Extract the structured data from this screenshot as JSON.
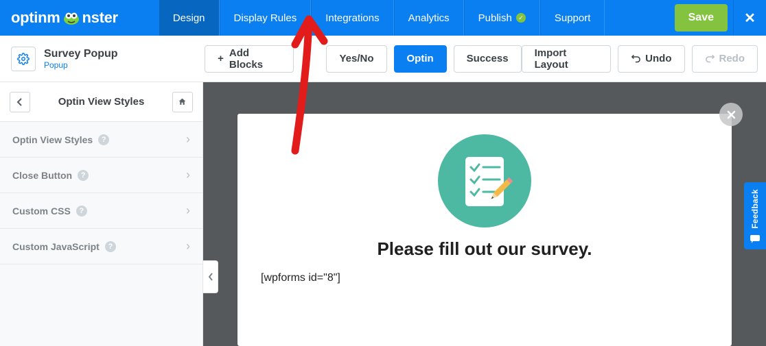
{
  "logo": {
    "part1": "optinm",
    "part2": "nster"
  },
  "topNav": {
    "tabs": [
      {
        "label": "Design",
        "active": true
      },
      {
        "label": "Display Rules"
      },
      {
        "label": "Integrations"
      },
      {
        "label": "Analytics"
      },
      {
        "label": "Publish",
        "badge": true
      },
      {
        "label": "Support"
      }
    ],
    "save": "Save"
  },
  "title": {
    "main": "Survey Popup",
    "sub": "Popup"
  },
  "toolbar": {
    "addBlocks": "Add Blocks",
    "views": {
      "yesno": "Yes/No",
      "optin": "Optin",
      "success": "Success"
    },
    "importLayout": "Import Layout",
    "undo": "Undo",
    "redo": "Redo"
  },
  "sidebar": {
    "header": "Optin View Styles",
    "items": [
      {
        "label": "Optin View Styles"
      },
      {
        "label": "Close Button"
      },
      {
        "label": "Custom CSS"
      },
      {
        "label": "Custom JavaScript"
      }
    ]
  },
  "popup": {
    "heading": "Please fill out our survey.",
    "shortcode": "[wpforms id=\"8\"]"
  },
  "feedback": {
    "label": "Feedback"
  }
}
